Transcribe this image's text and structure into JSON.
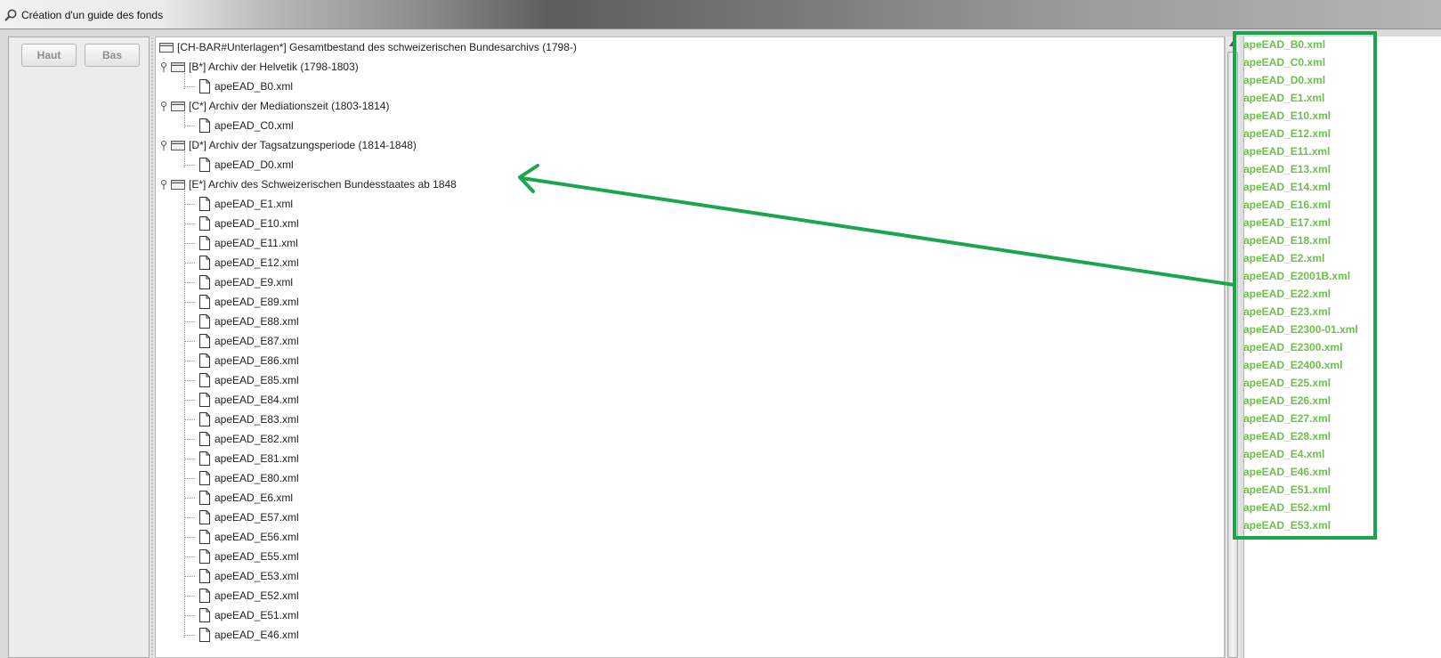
{
  "window": {
    "title": "Création d'un guide des fonds",
    "icon": "search-icon"
  },
  "toolbar": {
    "haut_label": "Haut",
    "bas_label": "Bas"
  },
  "tree": {
    "root": {
      "label": "[CH-BAR#Unterlagen*] Gesamtbestand des schweizerischen Bundesarchivs (1798-)"
    },
    "groups": [
      {
        "label": "[B*] Archiv der Helvetik (1798-1803)",
        "files": [
          "apeEAD_B0.xml"
        ]
      },
      {
        "label": "[C*] Archiv der Mediationszeit (1803-1814)",
        "files": [
          "apeEAD_C0.xml"
        ]
      },
      {
        "label": "[D*] Archiv der Tagsatzungsperiode (1814-1848)",
        "files": [
          "apeEAD_D0.xml"
        ]
      },
      {
        "label": "[E*] Archiv des Schweizerischen Bundesstaates ab 1848",
        "files": [
          "apeEAD_E1.xml",
          "apeEAD_E10.xml",
          "apeEAD_E11.xml",
          "apeEAD_E12.xml",
          "apeEAD_E9.xml",
          "apeEAD_E89.xml",
          "apeEAD_E88.xml",
          "apeEAD_E87.xml",
          "apeEAD_E86.xml",
          "apeEAD_E85.xml",
          "apeEAD_E84.xml",
          "apeEAD_E83.xml",
          "apeEAD_E82.xml",
          "apeEAD_E81.xml",
          "apeEAD_E80.xml",
          "apeEAD_E6.xml",
          "apeEAD_E57.xml",
          "apeEAD_E56.xml",
          "apeEAD_E55.xml",
          "apeEAD_E53.xml",
          "apeEAD_E52.xml",
          "apeEAD_E51.xml",
          "apeEAD_E46.xml"
        ]
      }
    ]
  },
  "right_list": {
    "items": [
      "apeEAD_B0.xml",
      "apeEAD_C0.xml",
      "apeEAD_D0.xml",
      "apeEAD_E1.xml",
      "apeEAD_E10.xml",
      "apeEAD_E12.xml",
      "apeEAD_E11.xml",
      "apeEAD_E13.xml",
      "apeEAD_E14.xml",
      "apeEAD_E16.xml",
      "apeEAD_E17.xml",
      "apeEAD_E18.xml",
      "apeEAD_E2.xml",
      "apeEAD_E2001B.xml",
      "apeEAD_E22.xml",
      "apeEAD_E23.xml",
      "apeEAD_E2300-01.xml",
      "apeEAD_E2300.xml",
      "apeEAD_E2400.xml",
      "apeEAD_E25.xml",
      "apeEAD_E26.xml",
      "apeEAD_E27.xml",
      "apeEAD_E28.xml",
      "apeEAD_E4.xml",
      "apeEAD_E46.xml",
      "apeEAD_E51.xml",
      "apeEAD_E52.xml",
      "apeEAD_E53.xml"
    ]
  },
  "colors": {
    "annotation": "#1aa64b",
    "list_text": "#6cc04a"
  }
}
